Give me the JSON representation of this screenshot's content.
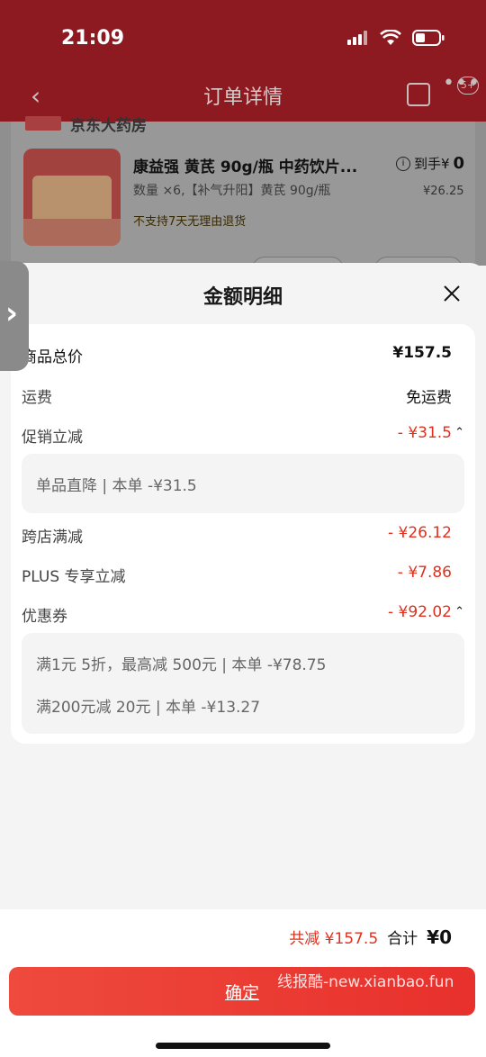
{
  "status": {
    "time": "21:09"
  },
  "nav": {
    "title": "订单详情",
    "more_badge": "5+"
  },
  "store": {
    "name": "京东大药房"
  },
  "product": {
    "title": "康益强 黄芪 90g/瓶 中药饮片...",
    "spec": "数量 ×6,【补气升阳】黄芪 90g/瓶",
    "policy": "不支持7天无理由退货",
    "in_hand_label": "到手¥",
    "in_hand_price": "0",
    "original_price": "¥26.25"
  },
  "sheet": {
    "title": "金额明细",
    "rows": {
      "total": {
        "label": "商品总价",
        "value": "¥157.5"
      },
      "shipping": {
        "label": "运费",
        "value": "免运费"
      },
      "promo": {
        "label": "促销立减",
        "value": "- ¥31.5",
        "detail": "单品直降 | 本单 -¥31.5"
      },
      "cross": {
        "label": "跨店满减",
        "value": "- ¥26.12"
      },
      "plus": {
        "label": "PLUS 专享立减",
        "value": "- ¥7.86"
      },
      "coupon": {
        "label": "优惠券",
        "value": "- ¥92.02",
        "details": [
          "满1元 5折，最高减 500元 | 本单 -¥78.75",
          "满200元减 20元 | 本单 -¥13.27"
        ]
      }
    }
  },
  "bottom": {
    "saved": "共减 ¥157.5",
    "total_label": "合计",
    "total_value": "¥0",
    "confirm_label": "确定",
    "watermark": "线报酷-new.xianbao.fun"
  },
  "colors": {
    "accent": "#e0301e",
    "header": "#8e1a21",
    "button": "#e8302c"
  }
}
